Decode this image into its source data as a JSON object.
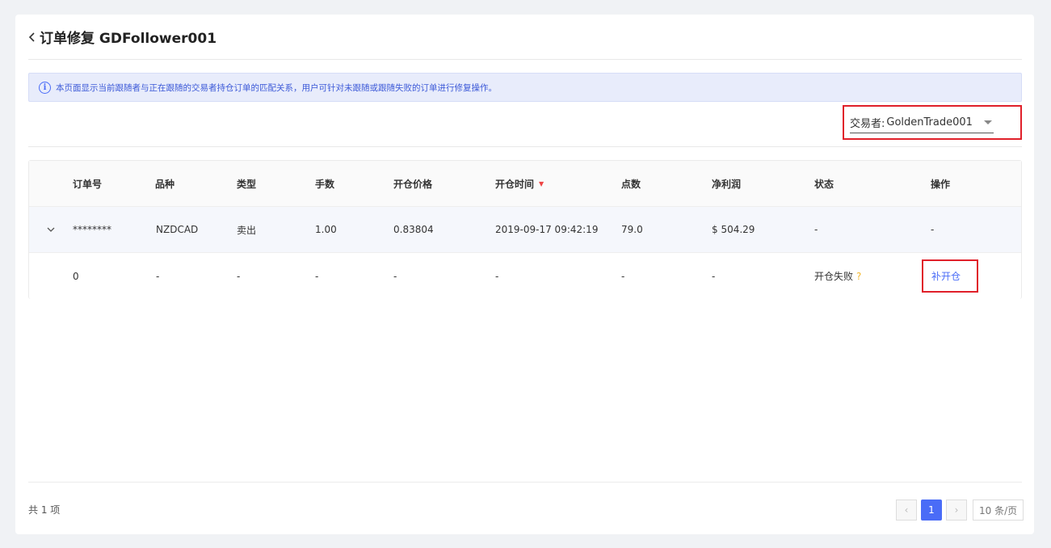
{
  "header": {
    "title": "订单修复 GDFollower001"
  },
  "notice": {
    "text": "本页面显示当前跟随者与正在跟随的交易者持仓订单的匹配关系，用户可针对未跟随或跟随失败的订单进行修复操作。"
  },
  "trader": {
    "label": "交易者:",
    "value": "GoldenTrade001"
  },
  "table": {
    "columns": [
      "订单号",
      "品种",
      "类型",
      "手数",
      "开仓价格",
      "开仓时间",
      "点数",
      "净利润",
      "状态",
      "操作"
    ],
    "main_row": [
      "********",
      "NZDCAD",
      "卖出",
      "1.00",
      "0.83804",
      "2019-09-17 09:42:19",
      "79.0",
      "$ 504.29",
      "-",
      "-"
    ],
    "sub_row": [
      "0",
      "-",
      "-",
      "-",
      "-",
      "-",
      "-",
      "-",
      "开仓失败",
      "补开仓"
    ],
    "help_glyph": "?"
  },
  "footer": {
    "total": "共 1 项",
    "prev": "‹",
    "page": "1",
    "next": "›",
    "page_size": "10 条/页"
  },
  "colors": {
    "accent": "#4a6cf7",
    "highlight_border": "#e0202a",
    "warning": "#f4b82e"
  },
  "icons": {
    "back": "chevron-left-icon",
    "info": "info-circle-icon",
    "caret": "caret-down-icon",
    "sort": "sort-down-icon",
    "expand": "chevron-down-icon",
    "help": "question-icon"
  }
}
